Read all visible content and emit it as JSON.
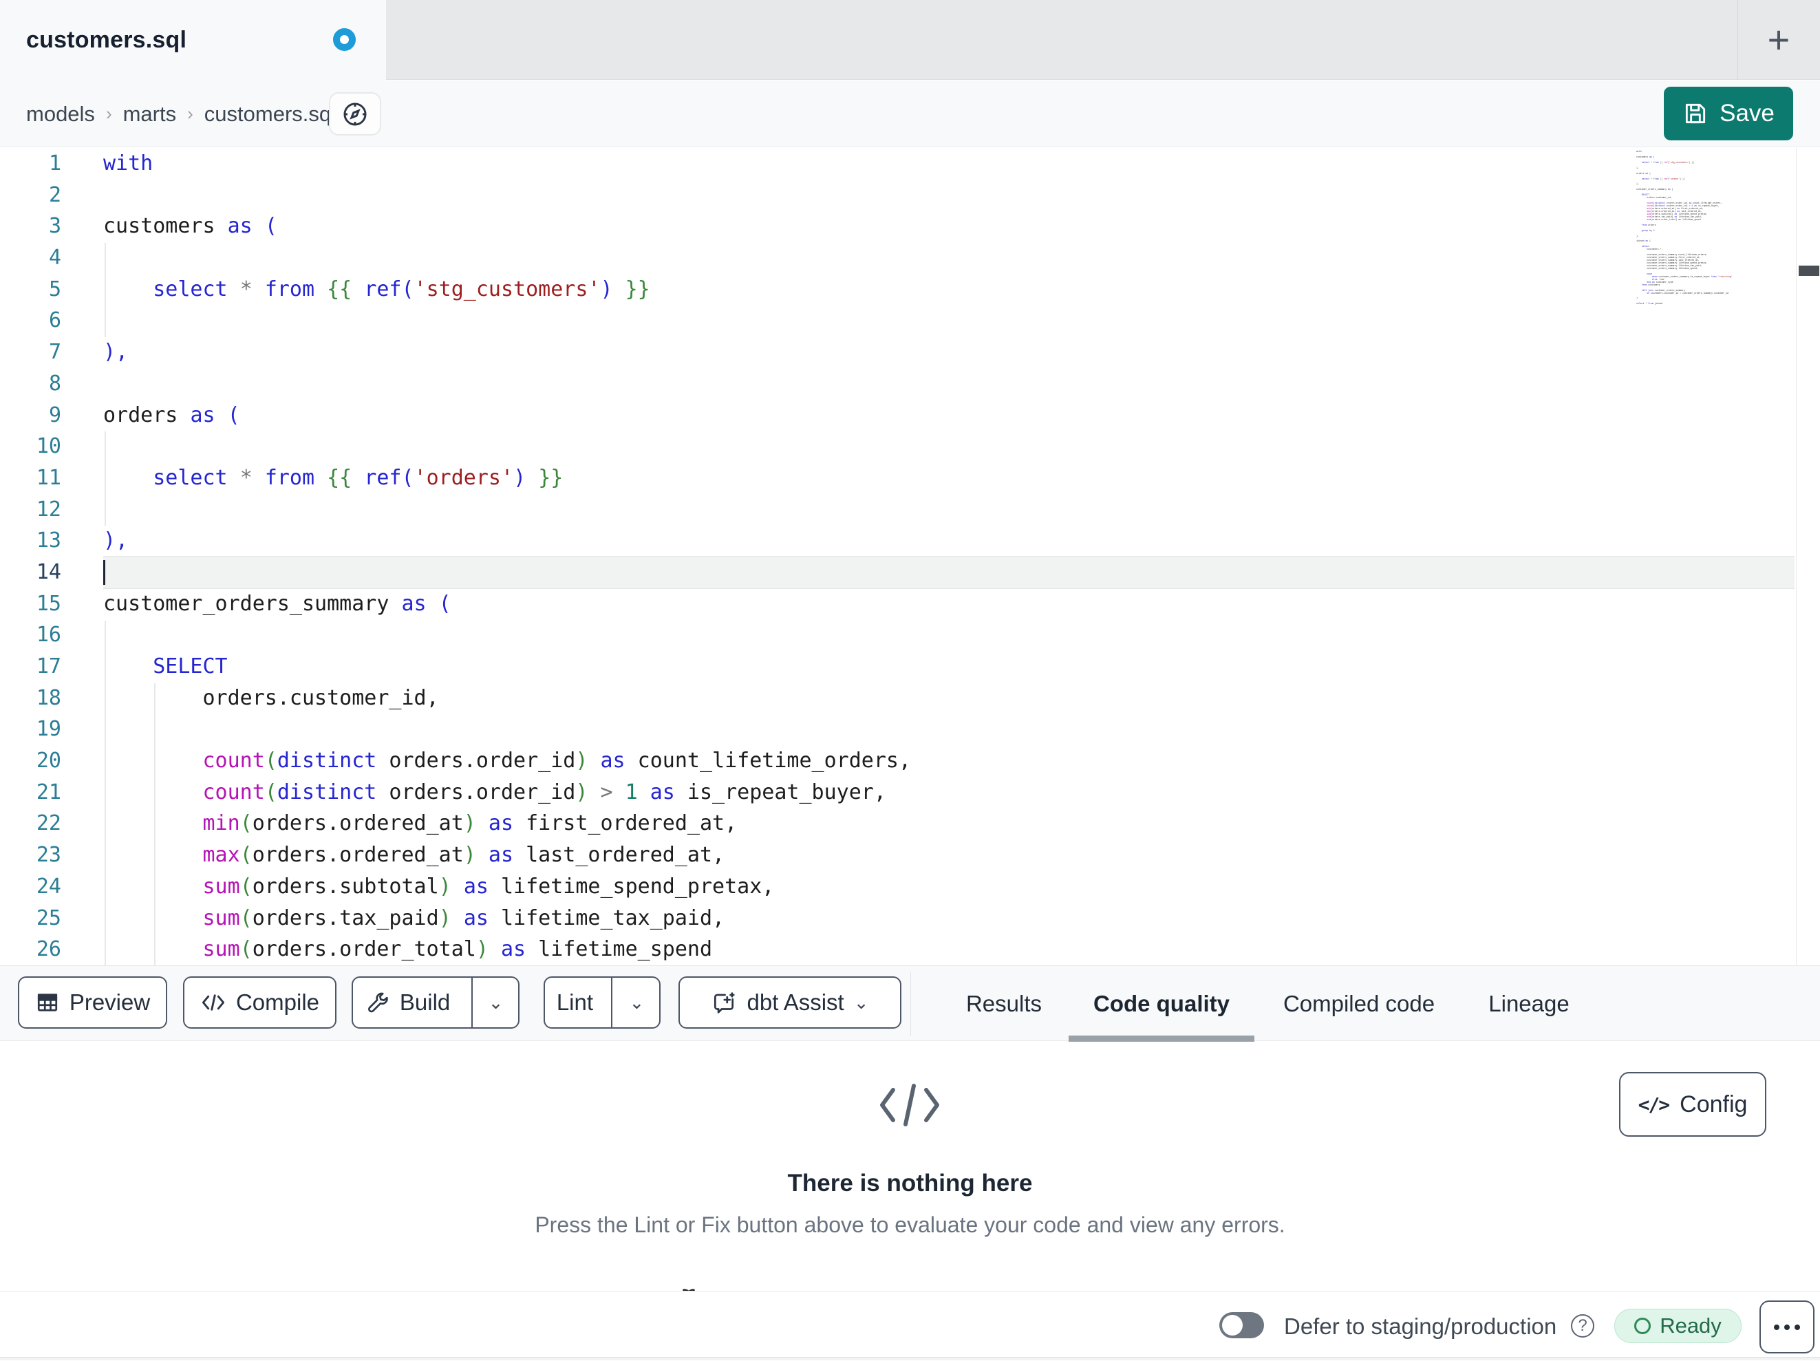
{
  "window": {
    "tab_title": "customers.sql",
    "new_tab_label": "+"
  },
  "breadcrumb": {
    "items": [
      "models",
      "marts",
      "customers.sql"
    ],
    "separator": "›"
  },
  "actions": {
    "save_label": "Save"
  },
  "editor": {
    "active_line": 14,
    "lines": [
      {
        "tokens": [
          [
            "kw",
            "with"
          ]
        ]
      },
      {
        "tokens": []
      },
      {
        "tokens": [
          [
            "txt",
            "customers "
          ],
          [
            "kw",
            "as"
          ],
          [
            "txt",
            " "
          ],
          [
            "kw",
            "("
          ]
        ]
      },
      {
        "tokens": []
      },
      {
        "tokens": [
          [
            "txt",
            "    "
          ],
          [
            "kw",
            "select"
          ],
          [
            "txt",
            " "
          ],
          [
            "op",
            "*"
          ],
          [
            "txt",
            " "
          ],
          [
            "kw",
            "from"
          ],
          [
            "txt",
            " "
          ],
          [
            "grn",
            "{{"
          ],
          [
            "txt",
            " "
          ],
          [
            "kw",
            "ref("
          ],
          [
            "str",
            "'stg_customers'"
          ],
          [
            "kw",
            ")"
          ],
          [
            "txt",
            " "
          ],
          [
            "grn",
            "}}"
          ]
        ]
      },
      {
        "tokens": []
      },
      {
        "tokens": [
          [
            "kw",
            "),"
          ]
        ]
      },
      {
        "tokens": []
      },
      {
        "tokens": [
          [
            "txt",
            "orders "
          ],
          [
            "kw",
            "as"
          ],
          [
            "txt",
            " "
          ],
          [
            "kw",
            "("
          ]
        ]
      },
      {
        "tokens": []
      },
      {
        "tokens": [
          [
            "txt",
            "    "
          ],
          [
            "kw",
            "select"
          ],
          [
            "txt",
            " "
          ],
          [
            "op",
            "*"
          ],
          [
            "txt",
            " "
          ],
          [
            "kw",
            "from"
          ],
          [
            "txt",
            " "
          ],
          [
            "grn",
            "{{"
          ],
          [
            "txt",
            " "
          ],
          [
            "kw",
            "ref("
          ],
          [
            "str",
            "'orders'"
          ],
          [
            "kw",
            ")"
          ],
          [
            "txt",
            " "
          ],
          [
            "grn",
            "}}"
          ]
        ]
      },
      {
        "tokens": []
      },
      {
        "tokens": [
          [
            "kw",
            "),"
          ]
        ]
      },
      {
        "tokens": []
      },
      {
        "tokens": [
          [
            "txt",
            "customer_orders_summary "
          ],
          [
            "kw",
            "as"
          ],
          [
            "txt",
            " "
          ],
          [
            "kw",
            "("
          ]
        ]
      },
      {
        "tokens": []
      },
      {
        "tokens": [
          [
            "txt",
            "    "
          ],
          [
            "kw",
            "SELECT"
          ]
        ]
      },
      {
        "tokens": [
          [
            "txt",
            "        orders.customer_id,"
          ]
        ]
      },
      {
        "tokens": []
      },
      {
        "tokens": [
          [
            "txt",
            "        "
          ],
          [
            "fn",
            "count"
          ],
          [
            "grn",
            "("
          ],
          [
            "kw",
            "distinct"
          ],
          [
            "txt",
            " orders.order_id"
          ],
          [
            "grn",
            ")"
          ],
          [
            "txt",
            " "
          ],
          [
            "kw",
            "as"
          ],
          [
            "txt",
            " count_lifetime_orders,"
          ]
        ]
      },
      {
        "tokens": [
          [
            "txt",
            "        "
          ],
          [
            "fn",
            "count"
          ],
          [
            "grn",
            "("
          ],
          [
            "kw",
            "distinct"
          ],
          [
            "txt",
            " orders.order_id"
          ],
          [
            "grn",
            ")"
          ],
          [
            "txt",
            " "
          ],
          [
            "op",
            ">"
          ],
          [
            "txt",
            " "
          ],
          [
            "num",
            "1"
          ],
          [
            "txt",
            " "
          ],
          [
            "kw",
            "as"
          ],
          [
            "txt",
            " is_repeat_buyer,"
          ]
        ]
      },
      {
        "tokens": [
          [
            "txt",
            "        "
          ],
          [
            "fn",
            "min"
          ],
          [
            "grn",
            "("
          ],
          [
            "txt",
            "orders.ordered_at"
          ],
          [
            "grn",
            ")"
          ],
          [
            "txt",
            " "
          ],
          [
            "kw",
            "as"
          ],
          [
            "txt",
            " first_ordered_at,"
          ]
        ]
      },
      {
        "tokens": [
          [
            "txt",
            "        "
          ],
          [
            "fn",
            "max"
          ],
          [
            "grn",
            "("
          ],
          [
            "txt",
            "orders.ordered_at"
          ],
          [
            "grn",
            ")"
          ],
          [
            "txt",
            " "
          ],
          [
            "kw",
            "as"
          ],
          [
            "txt",
            " last_ordered_at,"
          ]
        ]
      },
      {
        "tokens": [
          [
            "txt",
            "        "
          ],
          [
            "fn",
            "sum"
          ],
          [
            "grn",
            "("
          ],
          [
            "txt",
            "orders.subtotal"
          ],
          [
            "grn",
            ")"
          ],
          [
            "txt",
            " "
          ],
          [
            "kw",
            "as"
          ],
          [
            "txt",
            " lifetime_spend_pretax,"
          ]
        ]
      },
      {
        "tokens": [
          [
            "txt",
            "        "
          ],
          [
            "fn",
            "sum"
          ],
          [
            "grn",
            "("
          ],
          [
            "txt",
            "orders.tax_paid"
          ],
          [
            "grn",
            ")"
          ],
          [
            "txt",
            " "
          ],
          [
            "kw",
            "as"
          ],
          [
            "txt",
            " lifetime_tax_paid,"
          ]
        ]
      },
      {
        "tokens": [
          [
            "txt",
            "        "
          ],
          [
            "fn",
            "sum"
          ],
          [
            "grn",
            "("
          ],
          [
            "txt",
            "orders.order_total"
          ],
          [
            "grn",
            ")"
          ],
          [
            "txt",
            " "
          ],
          [
            "kw",
            "as"
          ],
          [
            "txt",
            " lifetime_spend"
          ]
        ]
      }
    ],
    "minimap_text": [
      "with",
      "",
      "customers as (",
      "",
      "    select * from {{ ref('stg_customers') }}",
      "",
      "),",
      "",
      "orders as (",
      "",
      "    select * from {{ ref('orders') }}",
      "",
      "),",
      "",
      "customer_orders_summary as (",
      "",
      "    SELECT",
      "        orders.customer_id,",
      "",
      "        count(distinct orders.order_id) as count_lifetime_orders,",
      "        count(distinct orders.order_id) > 1 as is_repeat_buyer,",
      "        min(orders.ordered_at) as first_ordered_at,",
      "        max(orders.ordered_at) as last_ordered_at,",
      "        sum(orders.subtotal) as lifetime_spend_pretax,",
      "        sum(orders.tax_paid) as lifetime_tax_paid,",
      "        sum(orders.order_total) as lifetime_spend",
      "",
      "    from orders",
      "",
      "    group by 1",
      "",
      "),",
      "",
      "joined as (",
      "",
      "    select",
      "        customers.*,",
      "",
      "        customer_orders_summary.count_lifetime_orders,",
      "        customer_orders_summary.first_ordered_at,",
      "        customer_orders_summary.last_ordered_at,",
      "        customer_orders_summary.lifetime_spend_pretax,",
      "        customer_orders_summary.lifetime_tax_paid,",
      "        customer_orders_summary.lifetime_spend,",
      "",
      "        case",
      "            when customer_orders_summary.is_repeat_buyer then 'returning'",
      "            else 'new'",
      "        end as customer_type",
      "    from customers",
      "",
      "    left join customer_orders_summary",
      "        on customers.customer_id = customer_orders_summary.customer_id",
      "",
      ")",
      "",
      "select * from joined"
    ]
  },
  "toolbar": {
    "preview_label": "Preview",
    "compile_label": "Compile",
    "build_label": "Build",
    "lint_label": "Lint",
    "dbt_assist_label": "dbt Assist"
  },
  "panel_tabs": {
    "results": "Results",
    "code_quality": "Code quality",
    "compiled_code": "Compiled code",
    "lineage": "Lineage",
    "active": "Code quality"
  },
  "empty_state": {
    "title": "There is nothing here",
    "subtitle": "Press the Lint or Fix button above to evaluate your code and view any errors.",
    "config_label": "Config"
  },
  "status_bar": {
    "defer_label": "Defer to staging/production",
    "ready_label": "Ready",
    "defer_toggle_on": false
  },
  "colors": {
    "accent_teal": "#0d7a70",
    "unsaved_dot_blue": "#1d9cd8",
    "ready_bg": "#dff5e9",
    "ready_text": "#236b49",
    "keyword_blue": "#2525d2",
    "function_magenta": "#b513b5",
    "string_maroon": "#9d1f1f",
    "jinja_green": "#3c873c",
    "line_number_teal": "#2b7e96"
  }
}
